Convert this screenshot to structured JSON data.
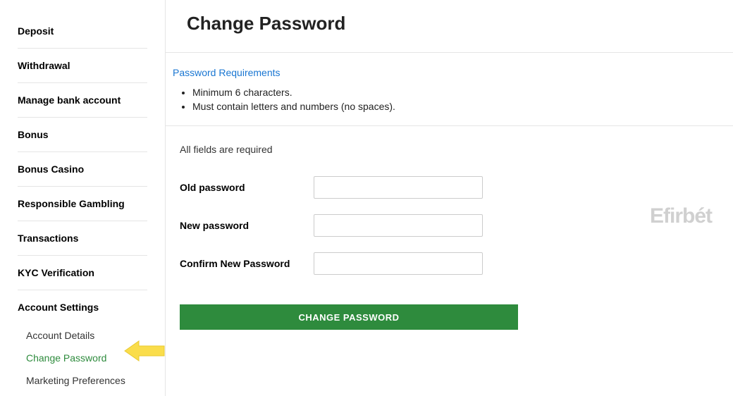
{
  "sidebar": {
    "items": [
      {
        "label": "Deposit"
      },
      {
        "label": "Withdrawal"
      },
      {
        "label": "Manage bank account"
      },
      {
        "label": "Bonus"
      },
      {
        "label": "Bonus Casino"
      },
      {
        "label": "Responsible Gambling"
      },
      {
        "label": "Transactions"
      },
      {
        "label": "KYC Verification"
      },
      {
        "label": "Account Settings"
      }
    ],
    "sub_items": [
      {
        "label": "Account Details"
      },
      {
        "label": "Change Password"
      },
      {
        "label": "Marketing Preferences"
      }
    ]
  },
  "main": {
    "title": "Change Password",
    "requirements": {
      "heading": "Password Requirements",
      "items": [
        "Minimum 6 characters.",
        "Must contain letters and numbers (no spaces)."
      ]
    },
    "form": {
      "all_required": "All fields are required",
      "old_password_label": "Old password",
      "new_password_label": "New password",
      "confirm_password_label": "Confirm New Password",
      "submit_label": "CHANGE PASSWORD"
    }
  },
  "watermark": "Efirbét"
}
